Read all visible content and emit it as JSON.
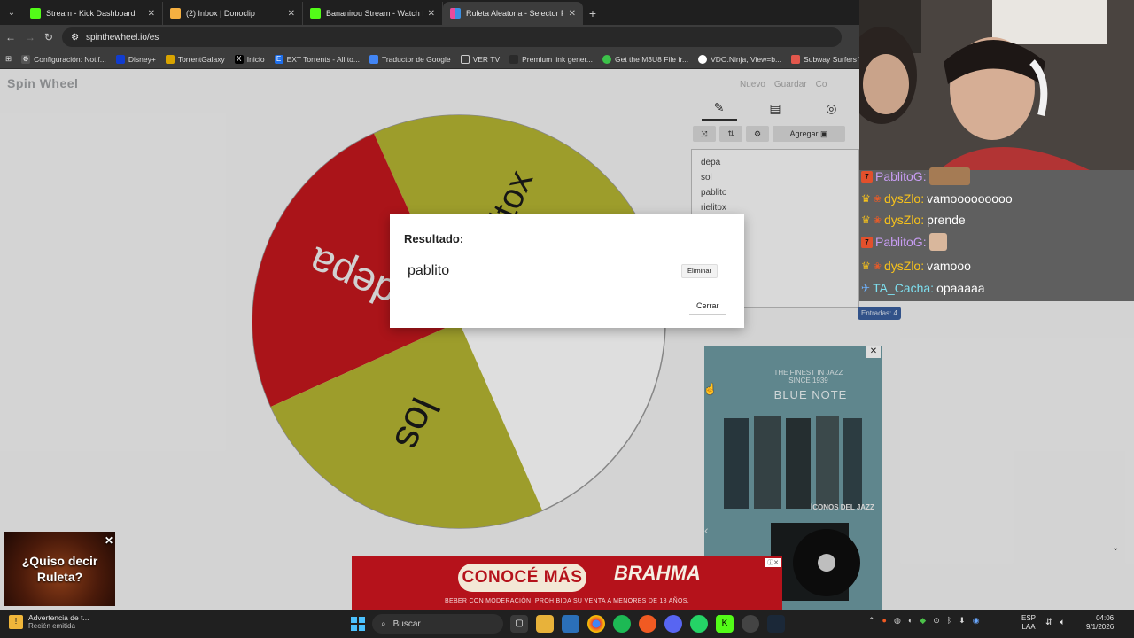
{
  "browser": {
    "tabs": [
      {
        "title": "Stream - Kick Dashboard",
        "color": "#53fc18"
      },
      {
        "title": "(2) Inbox | Donoclip",
        "color": "#f5b041"
      },
      {
        "title": "Bananirou Stream - Watch Live",
        "color": "#53fc18"
      },
      {
        "title": "Ruleta Aleatoria - Selector Pers",
        "color": "#e94b9c"
      }
    ],
    "address": "spinthewheel.io/es",
    "bookmarks": [
      "Configuración: Notif...",
      "Disney+",
      "TorrentGalaxy",
      "Inicio",
      "EXT Torrents - All to...",
      "Traductor de Google",
      "VER TV",
      "Premium link gener...",
      "Get the M3U8 File fr...",
      "VDO.Ninja, View=b...",
      "Subway Surfers Web"
    ]
  },
  "site": {
    "logo": "Spin Wheel",
    "actions": [
      "Nuevo",
      "Guardar",
      "Co"
    ]
  },
  "wheel": {
    "labels": [
      "rielitox",
      "depa",
      "los"
    ],
    "colors": {
      "yellow": "#b5b532",
      "red": "#c4171d",
      "white": "#ffffff"
    }
  },
  "panel": {
    "add_label": "Agregar",
    "entries": [
      "depa",
      "sol",
      "pablito",
      "rielitox"
    ],
    "entries_count": "Entradas: 4"
  },
  "modal": {
    "title": "Resultado:",
    "result": "pablito",
    "remove_label": "Eliminar",
    "close_label": "Cerrar"
  },
  "chat": [
    {
      "user": "PablitoG:",
      "text": "",
      "style": "p"
    },
    {
      "user": "dysZlo:",
      "text": " vamooooooooo",
      "style": "y"
    },
    {
      "user": "dysZlo:",
      "text": " prende",
      "style": "y"
    },
    {
      "user": "PablitoG:",
      "text": "",
      "style": "p"
    },
    {
      "user": "dysZlo:",
      "text": " vamooo",
      "style": "y"
    },
    {
      "user": "TA_Cacha:",
      "text": " opaaaaa",
      "style": "t"
    }
  ],
  "ads": {
    "right_headline": "THE FINEST IN JAZZ SINCE 1939",
    "right_brand": "BLUE NOTE",
    "right_caption": "ÍCONOS DEL JAZZ",
    "bottom_cta": "CONOCÉ MÁS",
    "bottom_brand": "BRAHMA",
    "bottom_legal": "BEBER CON MODERACIÓN. PROHIBIDA SU VENTA A MENORES DE 18 AÑOS."
  },
  "promo": {
    "line1": "¿Quiso decir",
    "line2": "Ruleta?"
  },
  "taskbar": {
    "notif_title": "Advertencia de t...",
    "notif_sub": "Recién emitida",
    "search": "Buscar",
    "lang1": "ESP",
    "lang2": "LAA",
    "time": "04:06",
    "date": "9/1/2026"
  }
}
